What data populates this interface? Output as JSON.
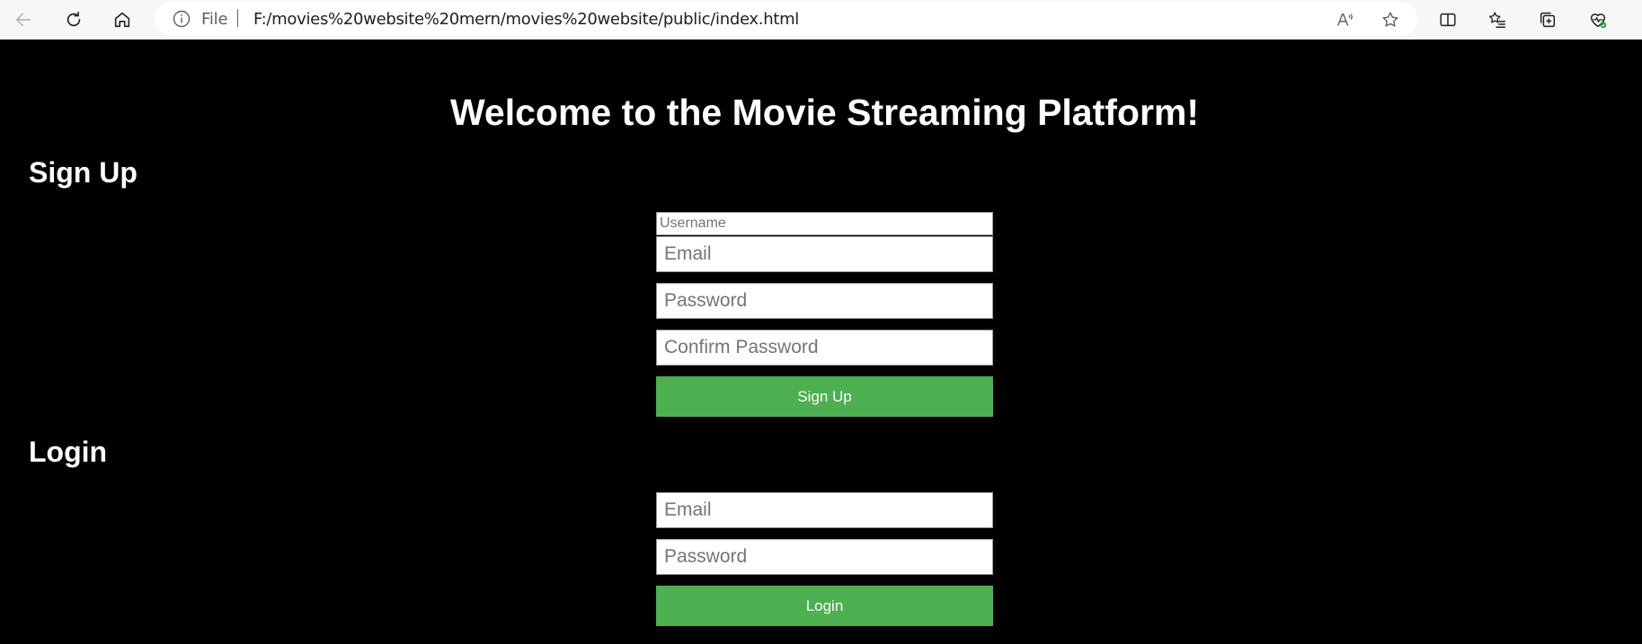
{
  "browser": {
    "address_prefix": "File",
    "url": "F:/movies%20website%20mern/movies%20website/public/index.html",
    "icons": [
      "back-icon",
      "refresh-icon",
      "home-icon",
      "info-icon",
      "read-aloud-icon",
      "favorite-star-icon",
      "split-screen-icon",
      "favorites-icon",
      "collections-icon",
      "browser-essentials-icon"
    ]
  },
  "page": {
    "title": "Welcome to the Movie Streaming Platform!",
    "signup": {
      "heading": "Sign Up",
      "username_placeholder": "Username",
      "email_placeholder": "Email",
      "password_placeholder": "Password",
      "confirm_password_placeholder": "Confirm Password",
      "button_label": "Sign Up"
    },
    "login": {
      "heading": "Login",
      "email_placeholder": "Email",
      "password_placeholder": "Password",
      "button_label": "Login"
    }
  },
  "colors": {
    "page_background": "#000000",
    "button": "#4caf50",
    "text": "#ffffff"
  }
}
